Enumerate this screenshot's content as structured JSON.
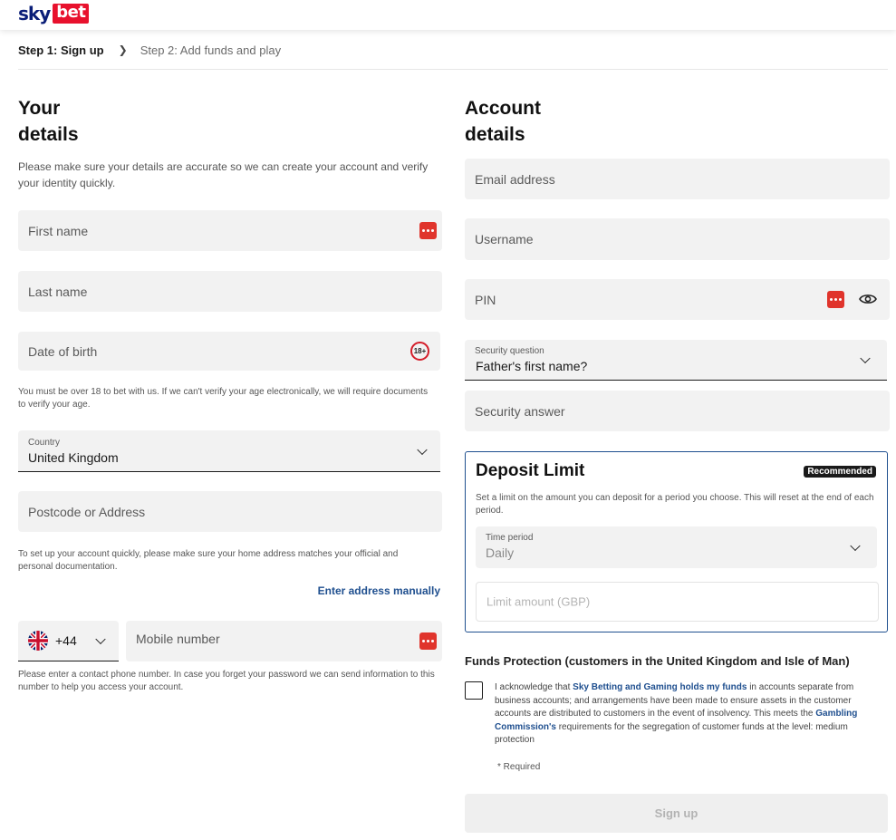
{
  "brand": {
    "sky": "sky",
    "bet": "bet"
  },
  "steps": {
    "step1": "Step 1: Sign up",
    "step2": "Step 2: Add funds and play"
  },
  "your_details": {
    "title_line1": "Your",
    "title_line2": "details",
    "description": "Please make sure your details are accurate so we can create your account and verify your identity quickly.",
    "first_name_placeholder": "First name",
    "last_name_placeholder": "Last name",
    "dob_placeholder": "Date of birth",
    "age_badge": "18+",
    "age_note": "You must be over 18 to bet with us. If we can't verify your age electronically, we will require documents to verify your age.",
    "country_label": "Country",
    "country_value": "United Kingdom",
    "postcode_placeholder": "Postcode or Address",
    "address_note": "To set up your account quickly, please make sure your home address matches your official and personal documentation.",
    "enter_address_manually": "Enter address manually",
    "phone_code": "+44",
    "mobile_placeholder": "Mobile number",
    "phone_note": "Please enter a contact phone number. In case you forget your password we can send information to this number to help you access your account."
  },
  "account_details": {
    "title_line1": "Account",
    "title_line2": "details",
    "email_placeholder": "Email address",
    "username_placeholder": "Username",
    "pin_placeholder": "PIN",
    "security_question_label": "Security question",
    "security_question_value": "Father's first name?",
    "security_answer_placeholder": "Security answer"
  },
  "deposit_limit": {
    "title": "Deposit Limit",
    "badge": "Recommended",
    "description": "Set a limit on the amount you can deposit for a period you choose. This will reset at the end of each period.",
    "time_period_label": "Time period",
    "time_period_value": "Daily",
    "limit_placeholder": "Limit amount (GBP)"
  },
  "funds_protection": {
    "title": "Funds Protection (customers in the United Kingdom and Isle of Man)",
    "text_a": "I acknowledge that ",
    "link_a": "Sky Betting and Gaming holds my funds",
    "text_b": " in accounts separate from business accounts; and arrangements have been made to ensure assets in the customer accounts are distributed to customers in the event of insolvency. This meets the ",
    "link_b": "Gambling Commission's",
    "text_c": " requirements for the segregation of customer funds at the level: medium protection",
    "required": "* Required"
  },
  "signup_button": "Sign up",
  "colors": {
    "brand_navy": "#0a1e78",
    "brand_red": "#e8112d",
    "link": "#1f4f8f",
    "field_bg": "#f2f2f2"
  }
}
